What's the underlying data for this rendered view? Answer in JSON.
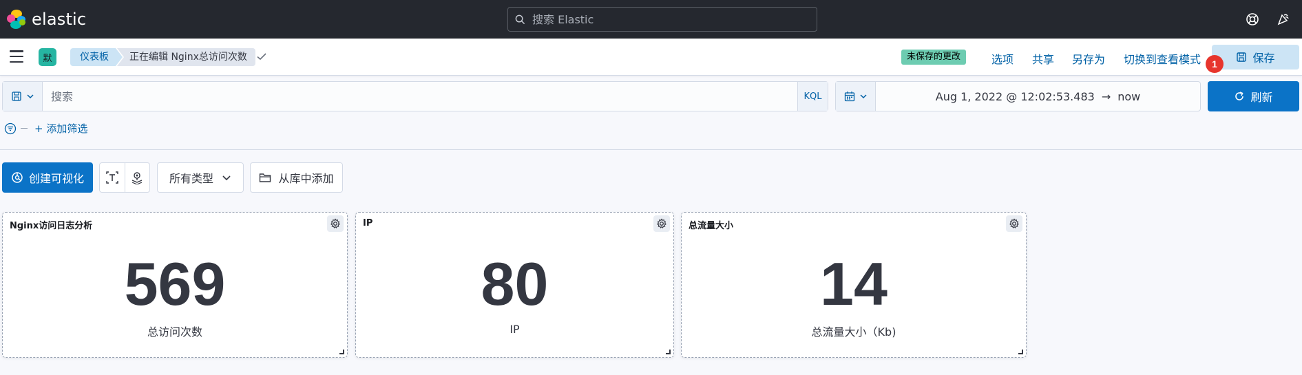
{
  "header": {
    "brand": "elastic",
    "search_placeholder": "搜索 Elastic"
  },
  "navbar": {
    "space_initial": "默",
    "breadcrumbs": [
      "仪表板",
      "正在编辑 Nginx总访问次数"
    ],
    "unsaved_badge": "未保存的更改",
    "links": {
      "options": "选项",
      "share": "共享",
      "save_as": "另存为",
      "view_mode": "切换到查看模式"
    },
    "save_label": "保存",
    "notification_count": "1"
  },
  "query_bar": {
    "search_placeholder": "搜索",
    "language": "KQL",
    "date_start": "Aug 1, 2022 @ 12:02:53.483",
    "date_arrow": "→",
    "date_end": "now",
    "refresh_label": "刷新"
  },
  "filters": {
    "add_filter": "+ 添加筛选"
  },
  "toolbar": {
    "create_label": "创建可视化",
    "types_label": "所有类型",
    "library_label": "从库中添加"
  },
  "panels": [
    {
      "title": "Nginx访问日志分析",
      "value": "569",
      "label": "总访问次数"
    },
    {
      "title": "IP",
      "value": "80",
      "label": "IP"
    },
    {
      "title": "总流量大小",
      "value": "14",
      "label": "总流量大小（Kb)"
    }
  ],
  "colors": {
    "header_bg": "#25282f",
    "primary": "#0b73c7",
    "link": "#0061a6",
    "unsaved_badge": "#6dccb1",
    "notification": "#e7352d"
  }
}
